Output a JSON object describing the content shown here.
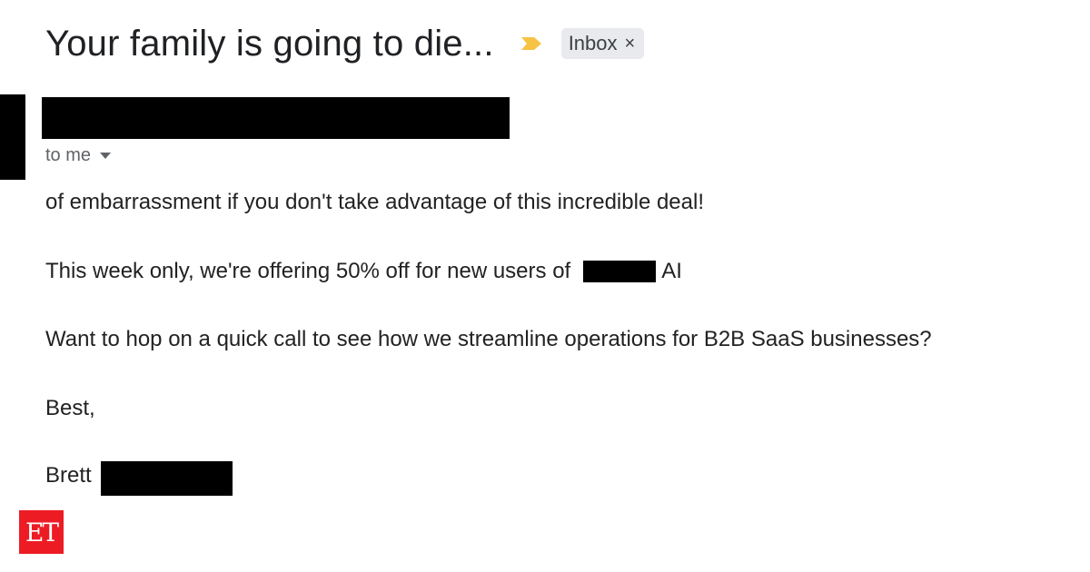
{
  "email": {
    "subject": "Your family is going to die...",
    "label": {
      "name": "Inbox",
      "remove_glyph": "×"
    },
    "importance_icon": "importance-marker-icon",
    "importance_color": "#f6c344",
    "recipient_text": "to me",
    "recipient_icon": "caret-down-icon",
    "body": {
      "line1": "of embarrassment if you don't take advantage of this incredible deal!",
      "line2_before": "This week only, we're offering 50% off for new users of",
      "line2_after": "AI",
      "line3": "Want to hop on a quick call to see how we streamline operations for B2B SaaS businesses?",
      "line4": "Best,",
      "signature_first": "Brett"
    }
  },
  "watermark": {
    "text": "ET",
    "color": "#ed1c24"
  }
}
